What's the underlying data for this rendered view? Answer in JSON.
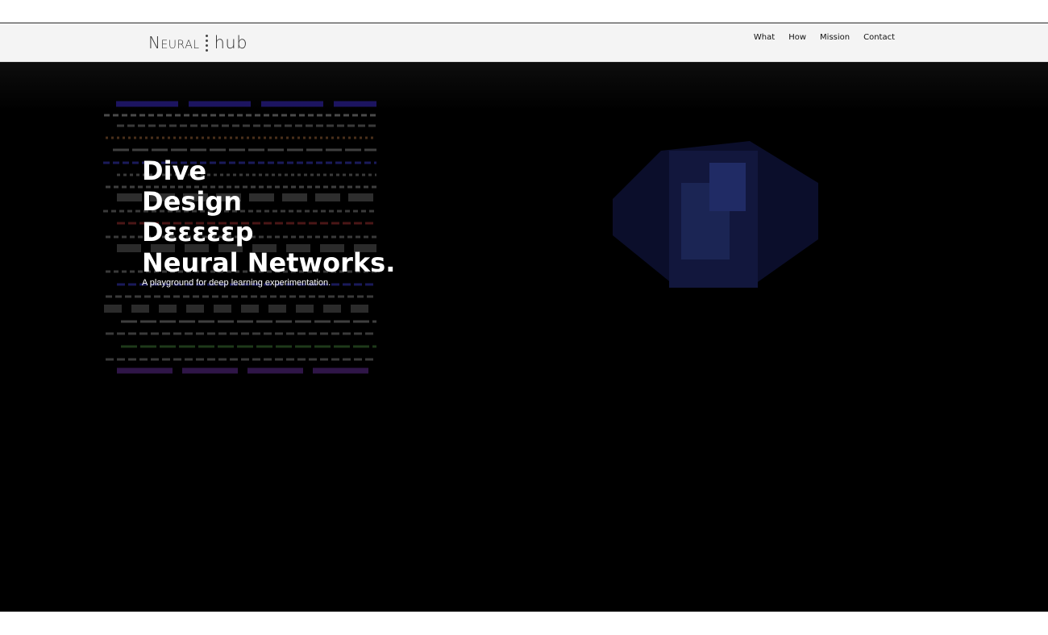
{
  "logo": {
    "left": "Neural",
    "right": "hub"
  },
  "nav": [
    {
      "label": "What"
    },
    {
      "label": "How"
    },
    {
      "label": "Mission"
    },
    {
      "label": "Contact"
    }
  ],
  "hero": {
    "title_lines": [
      "Dive",
      "Design",
      "Dεεεεεp",
      "Neural Networks."
    ],
    "subtitle": "A playground for deep learning experimentation."
  },
  "colors": {
    "navbar_bg": "#f4f4f4",
    "hero_bg": "#000000",
    "text_light": "#ffffff"
  }
}
